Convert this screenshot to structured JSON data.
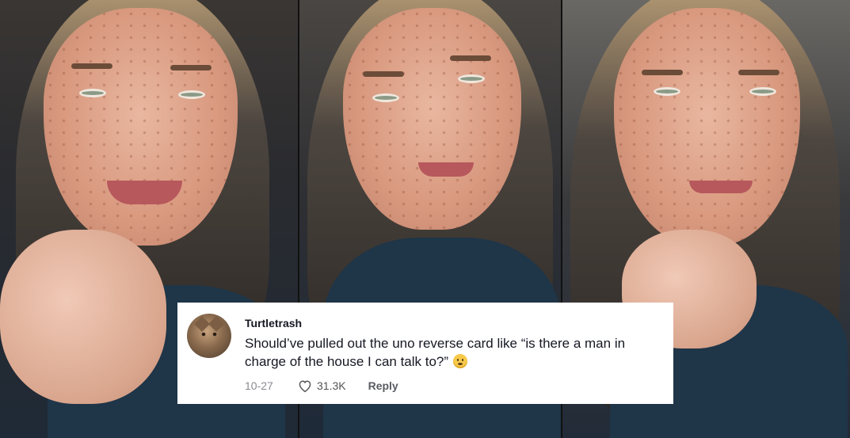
{
  "comment": {
    "username": "Turtletrash",
    "text": "Should’ve pulled out the uno reverse card like “is there a man in charge of the house I can talk to?”",
    "emoji": "face-with-open-mouth-emoji",
    "date": "10-27",
    "likes": "31.3K",
    "reply_label": "Reply",
    "icons": {
      "avatar": "cat-avatar",
      "like": "heart-icon"
    }
  },
  "colors": {
    "card_bg": "#ffffff",
    "text": "#161823",
    "meta": "#8a8b91"
  }
}
